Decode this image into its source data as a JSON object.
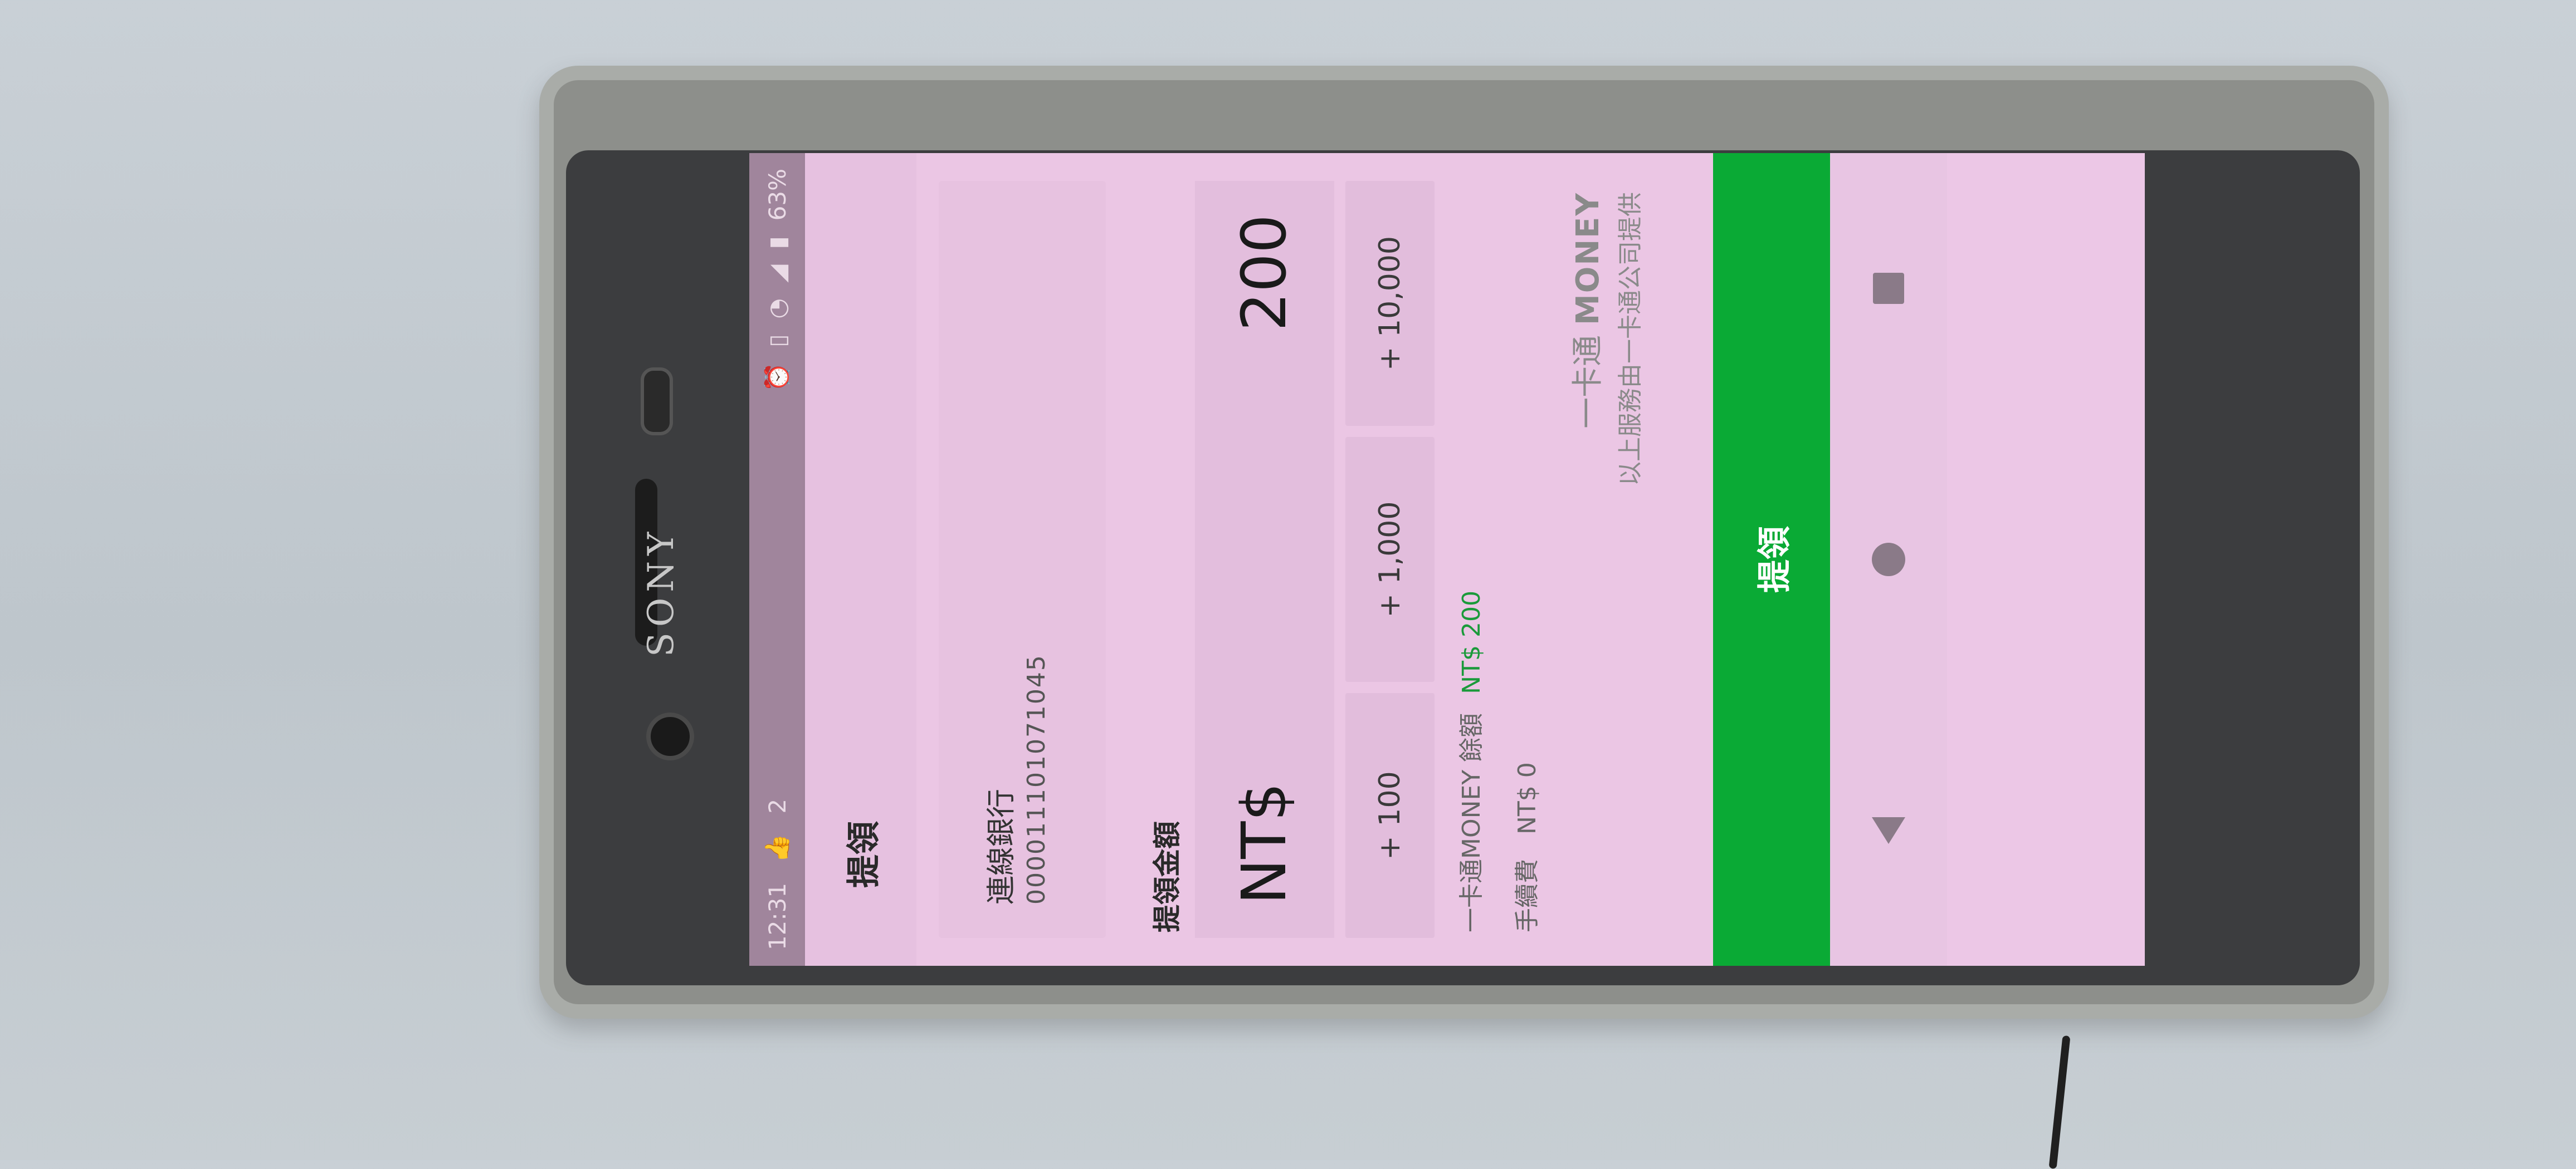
{
  "device": {
    "brand": "SONY"
  },
  "status_bar": {
    "time": "12:31",
    "notification_count": "2",
    "battery": "63%"
  },
  "app_bar": {
    "title": "提領"
  },
  "bank": {
    "name": "連線銀行",
    "account": "000011101071045"
  },
  "withdraw": {
    "label": "提領金額",
    "currency": "NT$",
    "amount": "200"
  },
  "quick_amounts": [
    "+ 100",
    "+ 1,000",
    "+ 10,000"
  ],
  "balance": {
    "label": "一卡通MONEY 餘額",
    "value": "NT$ 200",
    "color": "#1a9a3a"
  },
  "fee": {
    "label": "手續費",
    "value": "NT$ 0"
  },
  "provider": {
    "brand_prefix": "一卡通",
    "brand_name": "MONEY",
    "note": "以上服務由一卡通公司提供"
  },
  "cta": {
    "label": "提領",
    "color": "#0aaa35"
  },
  "nav": {
    "back_icon": "triangle-back-icon",
    "home_icon": "circle-home-icon",
    "recents_icon": "square-recents-icon"
  }
}
